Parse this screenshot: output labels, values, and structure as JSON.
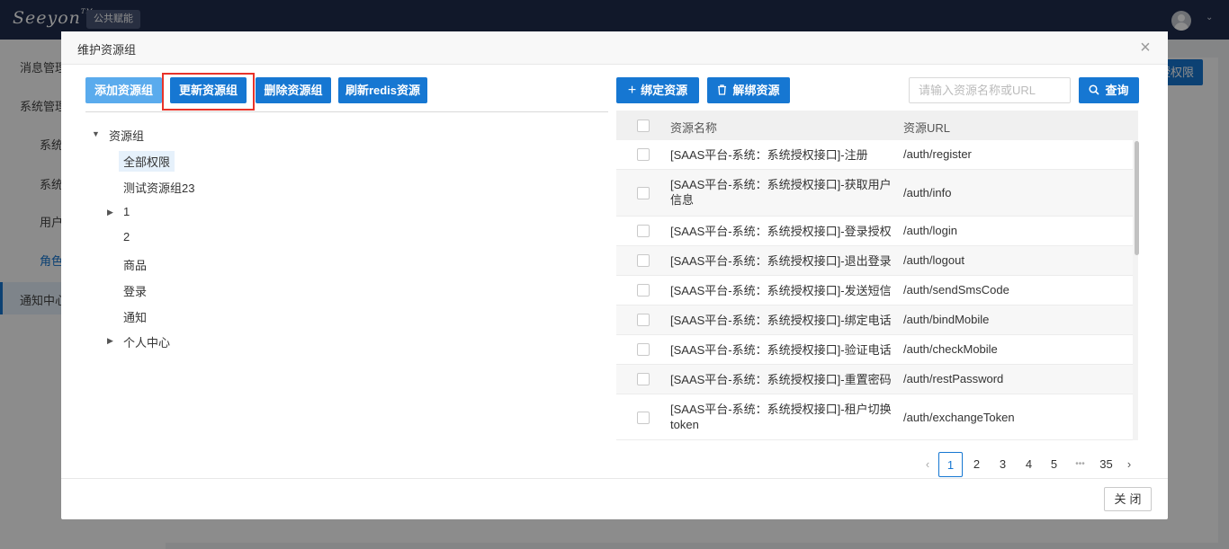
{
  "app": {
    "logo_text": "Seeyon",
    "logo_tm": "TM",
    "badge": "公共赋能"
  },
  "sidebar": {
    "items": [
      {
        "label": "消息管理"
      },
      {
        "label": "系统管理"
      },
      {
        "label": "系统"
      },
      {
        "label": "系统"
      },
      {
        "label": "用户"
      },
      {
        "label": "角色"
      },
      {
        "label": "通知中心"
      }
    ]
  },
  "background": {
    "top_right_button": "授权限"
  },
  "modal": {
    "title": "维护资源组",
    "close_icon": "×",
    "toolbar_left": {
      "add": "添加资源组",
      "update": "更新资源组",
      "delete": "删除资源组",
      "refresh": "刷新redis资源"
    },
    "toolbar_right": {
      "bind": "绑定资源",
      "unbind": "解绑资源",
      "search_placeholder": "请输入资源名称或URL",
      "search": "查询"
    },
    "tree": {
      "root": "资源组",
      "nodes": [
        {
          "label": "全部权限",
          "selected": true,
          "has_children": false
        },
        {
          "label": "测试资源组23",
          "has_children": false
        },
        {
          "label": "1",
          "has_children": true
        },
        {
          "label": "2",
          "has_children": false
        },
        {
          "label": "商品",
          "has_children": false
        },
        {
          "label": "登录",
          "has_children": false
        },
        {
          "label": "通知",
          "has_children": false
        },
        {
          "label": "个人中心",
          "has_children": true
        }
      ]
    },
    "table": {
      "headers": {
        "name": "资源名称",
        "url": "资源URL"
      },
      "rows": [
        {
          "name": "[SAAS平台-系统：系统授权接口]-注册",
          "url": "/auth/register"
        },
        {
          "name": "[SAAS平台-系统：系统授权接口]-获取用户信息",
          "url": "/auth/info"
        },
        {
          "name": "[SAAS平台-系统：系统授权接口]-登录授权",
          "url": "/auth/login"
        },
        {
          "name": "[SAAS平台-系统：系统授权接口]-退出登录",
          "url": "/auth/logout"
        },
        {
          "name": "[SAAS平台-系统：系统授权接口]-发送短信",
          "url": "/auth/sendSmsCode"
        },
        {
          "name": "[SAAS平台-系统：系统授权接口]-绑定电话",
          "url": "/auth/bindMobile"
        },
        {
          "name": "[SAAS平台-系统：系统授权接口]-验证电话",
          "url": "/auth/checkMobile"
        },
        {
          "name": "[SAAS平台-系统：系统授权接口]-重置密码",
          "url": "/auth/restPassword"
        },
        {
          "name": "[SAAS平台-系统：系统授权接口]-租户切换token",
          "url": "/auth/exchangeToken"
        }
      ]
    },
    "pagination": {
      "prev": "‹",
      "pages": [
        "1",
        "2",
        "3",
        "4",
        "5"
      ],
      "ellipsis": "•••",
      "last": "35",
      "next": "›",
      "current": "1"
    },
    "footer": {
      "close": "关闭"
    }
  },
  "colors": {
    "primary": "#1677d2",
    "primary_light": "#5aabed",
    "highlight": "#e8332a",
    "topbar": "#1f2d4e"
  },
  "icons": {
    "plus": "plus-icon",
    "trash": "trash-icon",
    "search": "search-icon",
    "close": "close-icon",
    "caret_down": "caret-down-icon",
    "caret_right": "caret-right-icon"
  }
}
